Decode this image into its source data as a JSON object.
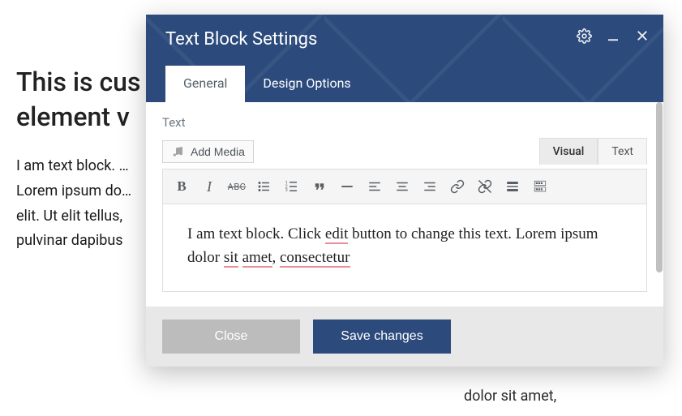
{
  "background": {
    "heading": "This is cus…\nelement w…",
    "paragraph_lines": [
      "I am text block. …",
      "Lorem ipsum do…",
      "elit. Ut elit tellus,",
      "pulvinar dapibus"
    ],
    "bottom_fragment": "dolor sit amet,"
  },
  "modal": {
    "title": "Text Block Settings",
    "tabs": {
      "general": "General",
      "design": "Design Options"
    },
    "field_label": "Text",
    "add_media": "Add Media",
    "modes": {
      "visual": "Visual",
      "text": "Text"
    },
    "toolbar": {
      "bold": "B",
      "italic": "I",
      "strike": "ABC"
    },
    "content_fragments": {
      "p1_before_edit": "I am text block. Click ",
      "edit": "edit",
      "p1_after_edit": " button to change this",
      "p2_before_sit": "text. Lorem ipsum dolor ",
      "sit": "sit",
      "p2_between": " ",
      "amet": "amet",
      "p2_after": ", ",
      "consectetur": "consectetur"
    },
    "footer": {
      "close": "Close",
      "save": "Save changes"
    }
  }
}
